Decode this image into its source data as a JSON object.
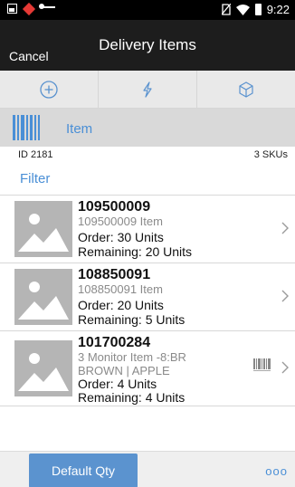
{
  "status_bar": {
    "time": "9:22"
  },
  "header": {
    "cancel_label": "Cancel",
    "title": "Delivery Items"
  },
  "toolbar": {
    "icons": [
      "add-circle-icon",
      "lightning-icon",
      "box-icon"
    ]
  },
  "scan": {
    "label": "Item"
  },
  "summary": {
    "id": "ID 2181",
    "skus": "3 SKUs"
  },
  "filter": {
    "label": "Filter"
  },
  "items": [
    {
      "sku": "109500009",
      "name": "109500009 Item",
      "order": "Order:  30  Units",
      "remaining": "Remaining:  20  Units"
    },
    {
      "sku": "108850091",
      "name": "108850091 Item",
      "order": "Order:  20  Units",
      "remaining": "Remaining:  5  Units"
    },
    {
      "sku": "101700284",
      "name": "3 Monitor Item -8:BR",
      "name2": "BROWN | APPLE",
      "order": "Order:  4  Units",
      "remaining": "Remaining:  4  Units"
    }
  ],
  "footer": {
    "default_qty_label": "Default Qty",
    "more_label": "ooo"
  },
  "colors": {
    "accent": "#4a8fd6",
    "button": "#5b93cf",
    "header": "#1d1d1d"
  }
}
